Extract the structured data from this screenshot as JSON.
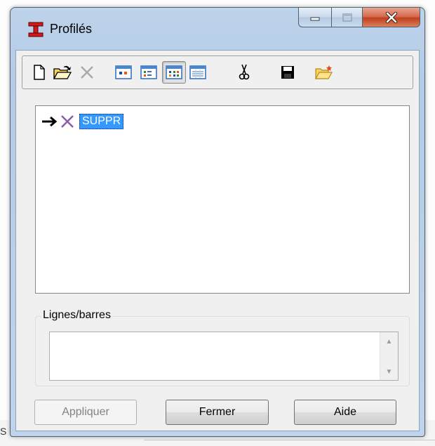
{
  "window": {
    "title": "Profilés",
    "caption_buttons": [
      "minimize",
      "maximize",
      "close"
    ]
  },
  "toolbar": {
    "items": [
      {
        "icon": "new-document-icon",
        "enabled": true
      },
      {
        "icon": "open-folder-icon",
        "enabled": true
      },
      {
        "icon": "delete-x-icon",
        "enabled": false
      },
      {
        "icon": "view-large-icons-icon",
        "enabled": true
      },
      {
        "icon": "view-small-icons-icon",
        "enabled": true
      },
      {
        "icon": "view-list-icon",
        "enabled": true,
        "pressed": true
      },
      {
        "icon": "view-details-icon",
        "enabled": true
      },
      {
        "icon": "cut-scissors-icon",
        "enabled": true
      },
      {
        "icon": "save-disk-icon",
        "enabled": true
      },
      {
        "icon": "open-star-folder-icon",
        "enabled": true
      }
    ]
  },
  "tree": {
    "items": [
      {
        "label": "SUPPR",
        "selected": true,
        "icons": [
          "arrow-right-icon",
          "delete-cross-icon"
        ]
      }
    ]
  },
  "group": {
    "legend": "Lignes/barres",
    "value": ""
  },
  "background": {
    "partial_text": "S ("
  },
  "buttons": {
    "apply": "Appliquer",
    "close": "Fermer",
    "help": "Aide"
  },
  "colors": {
    "selection": "#3399ff",
    "close_button": "#c2401e",
    "frame": "#b9d0e8"
  }
}
